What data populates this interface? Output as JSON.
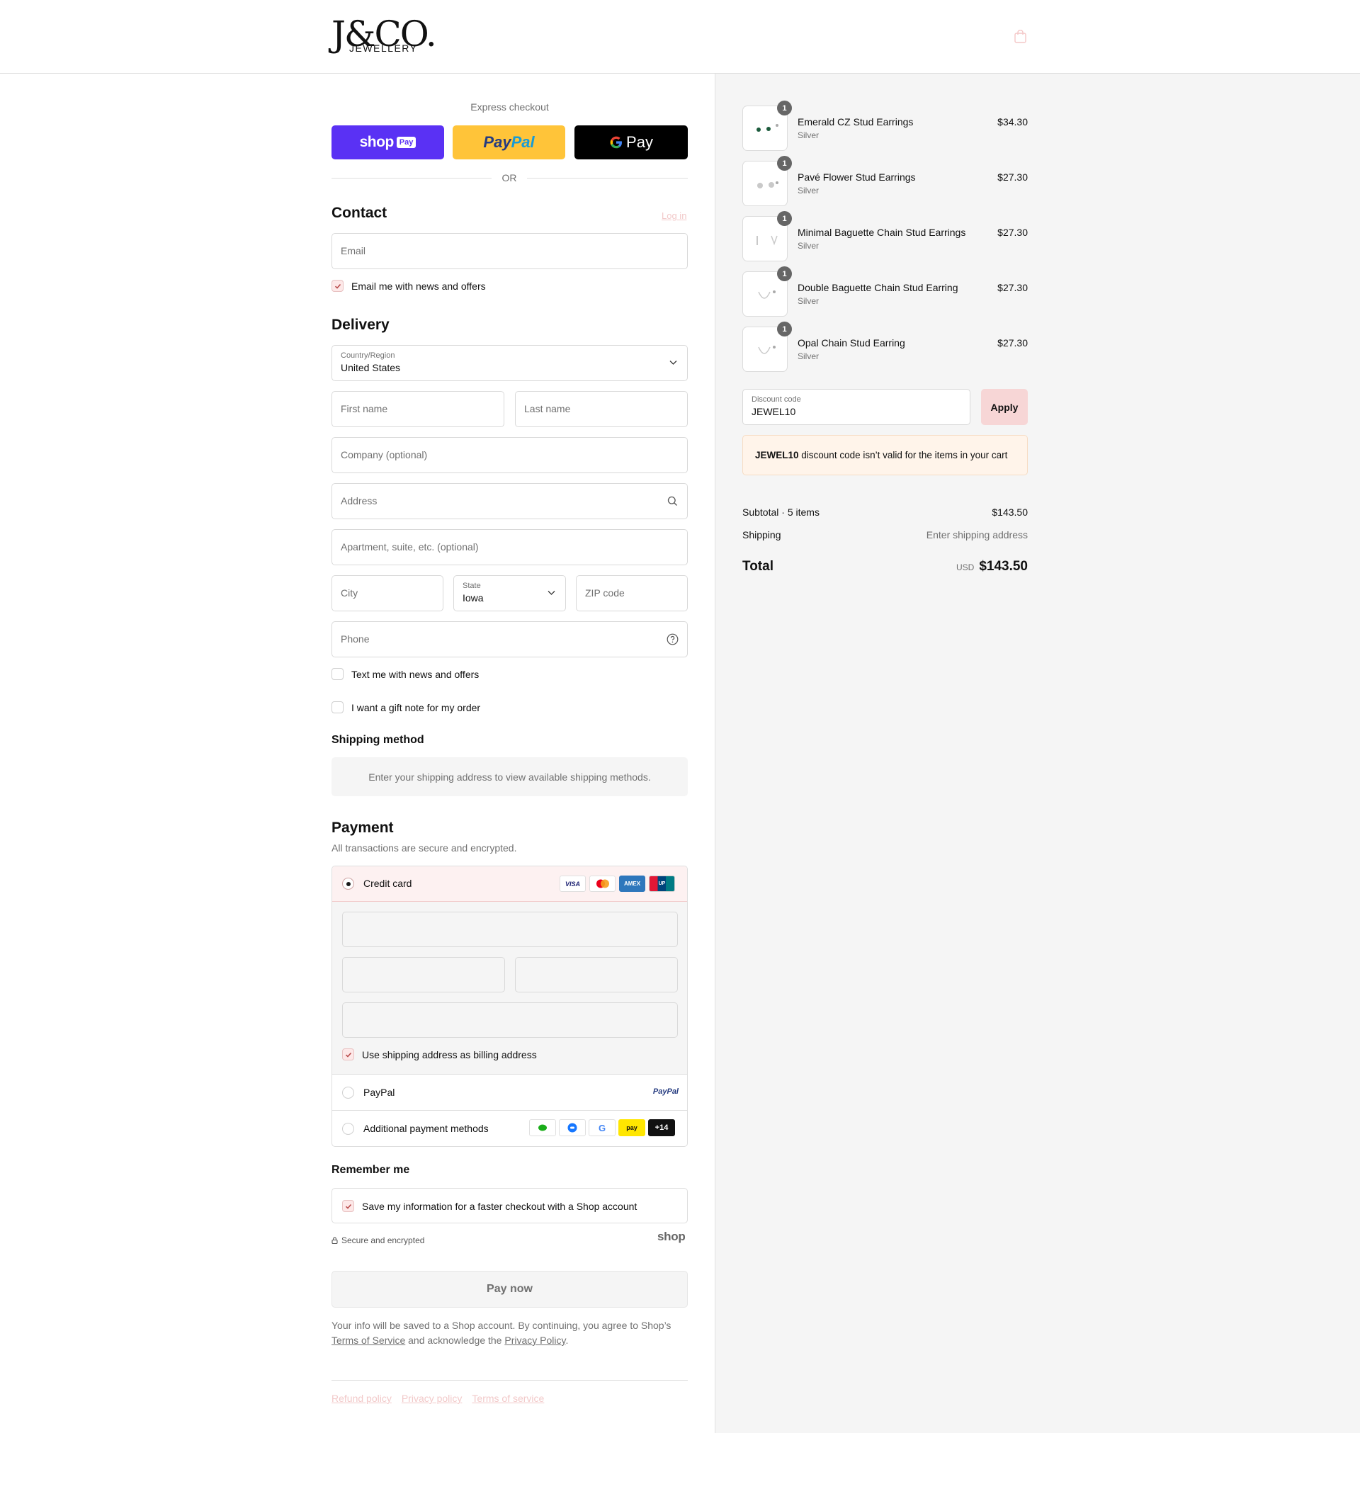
{
  "brand": {
    "name": "J&CO.",
    "subtitle": "JEWELLERY"
  },
  "express": {
    "title": "Express checkout",
    "shop_pay": {
      "label": "shop",
      "badge": "Pay"
    },
    "paypal": {
      "label_a": "Pay",
      "label_b": "Pal"
    },
    "gpay": {
      "label": "Pay"
    },
    "or": "OR"
  },
  "contact": {
    "title": "Contact",
    "login": "Log in",
    "email_placeholder": "Email",
    "news_label": "Email me with news and offers",
    "news_checked": true
  },
  "delivery": {
    "title": "Delivery",
    "country_label": "Country/Region",
    "country_value": "United States",
    "first_name": "First name",
    "last_name": "Last name",
    "company": "Company (optional)",
    "address": "Address",
    "apartment": "Apartment, suite, etc. (optional)",
    "city": "City",
    "state_label": "State",
    "state_value": "Iowa",
    "zip": "ZIP code",
    "phone": "Phone",
    "text_news": "Text me with news and offers",
    "gift_note": "I want a gift note for my order"
  },
  "shipping_method": {
    "title": "Shipping method",
    "message": "Enter your shipping address to view available shipping methods."
  },
  "payment": {
    "title": "Payment",
    "subtitle": "All transactions are secure and encrypted.",
    "credit_card": "Credit card",
    "card_brands": [
      "VISA",
      "Mastercard",
      "AMEX",
      "UnionPay"
    ],
    "billing_same": "Use shipping address as billing address",
    "paypal": "PayPal",
    "paypal_logo": "PayPal",
    "additional": "Additional payment methods",
    "more_count": "+14",
    "pay_badge": "pay"
  },
  "remember": {
    "title": "Remember me",
    "save_label": "Save my information for a faster checkout with a Shop account",
    "secure": "Secure and encrypted",
    "shop_logo": "shop"
  },
  "pay_now": "Pay now",
  "legal": {
    "text1": "Your info will be saved to a Shop account. By continuing, you agree to Shop’s",
    "terms": "Terms of Service",
    "text2": "and acknowledge the",
    "privacy": "Privacy Policy",
    "dot": "."
  },
  "footer_links": [
    "Refund policy",
    "Privacy policy",
    "Terms of service"
  ],
  "cart": {
    "items": [
      {
        "name": "Emerald CZ Stud Earrings",
        "variant": "Silver",
        "price": "$34.30",
        "qty": "1"
      },
      {
        "name": "Pavé Flower Stud Earrings",
        "variant": "Silver",
        "price": "$27.30",
        "qty": "1"
      },
      {
        "name": "Minimal Baguette Chain Stud Earrings",
        "variant": "Silver",
        "price": "$27.30",
        "qty": "1"
      },
      {
        "name": "Double Baguette Chain Stud Earring",
        "variant": "Silver",
        "price": "$27.30",
        "qty": "1"
      },
      {
        "name": "Opal Chain Stud Earring",
        "variant": "Silver",
        "price": "$27.30",
        "qty": "1"
      }
    ],
    "discount_label": "Discount code",
    "discount_value": "JEWEL10",
    "apply": "Apply",
    "error_code": "JEWEL10",
    "error_msg": " discount code isn’t valid for the items in your cart",
    "subtotal_label": "Subtotal · 5 items",
    "subtotal_value": "$143.50",
    "shipping_label": "Shipping",
    "shipping_value": "Enter shipping address",
    "total_label": "Total",
    "currency": "USD",
    "total_value": "$143.50"
  },
  "colors": {
    "accent": "#f7d6d6",
    "shop": "#5a31f4",
    "paypal": "#ffc439"
  }
}
